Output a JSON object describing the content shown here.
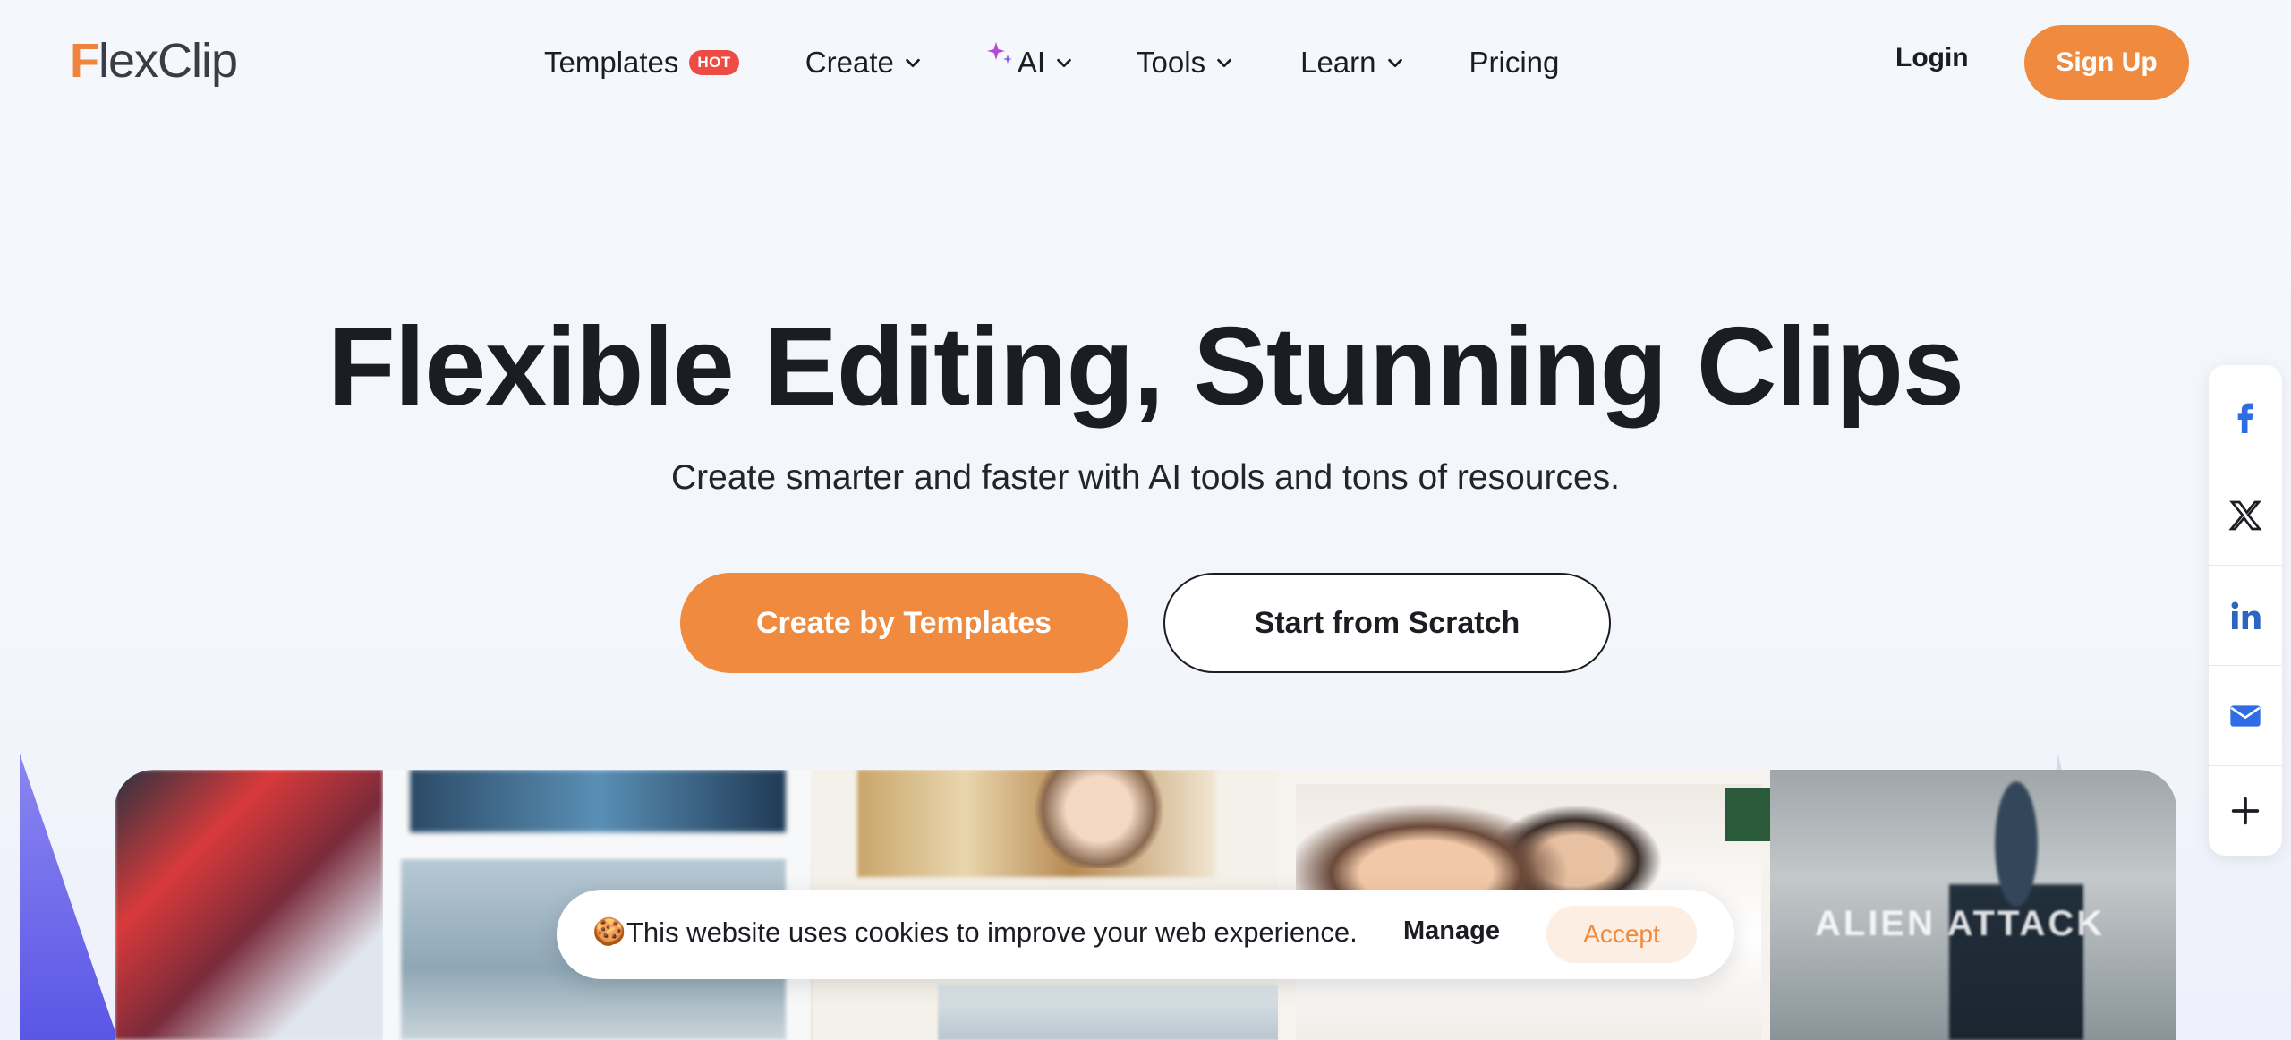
{
  "brand": {
    "logo_first": "F",
    "logo_rest": "lexClip",
    "accent_color": "#f08a3f"
  },
  "nav": {
    "items": [
      {
        "label": "Templates",
        "badge": "HOT"
      },
      {
        "label": "Create",
        "icon": "chevron-down-icon"
      },
      {
        "label": "AI",
        "icon": "chevron-down-icon",
        "prefix_icon": "sparkle-icon"
      },
      {
        "label": "Tools",
        "icon": "chevron-down-icon"
      },
      {
        "label": "Learn",
        "icon": "chevron-down-icon"
      },
      {
        "label": "Pricing"
      }
    ],
    "login_label": "Login",
    "signup_label": "Sign Up"
  },
  "hero": {
    "title": "Flexible Editing, Stunning Clips",
    "subtitle": "Create smarter and faster with AI tools and tons of resources.",
    "primary_cta": "Create by Templates",
    "secondary_cta": "Start from Scratch"
  },
  "showcase": {
    "overlay_text": "ALIEN ATTACK"
  },
  "social": {
    "items": [
      "facebook-icon",
      "x-icon",
      "linkedin-icon",
      "email-icon",
      "plus-icon"
    ]
  },
  "cookie": {
    "icon": "🍪",
    "message": "This website uses cookies to improve your web experience.",
    "manage_label": "Manage",
    "accept_label": "Accept"
  }
}
